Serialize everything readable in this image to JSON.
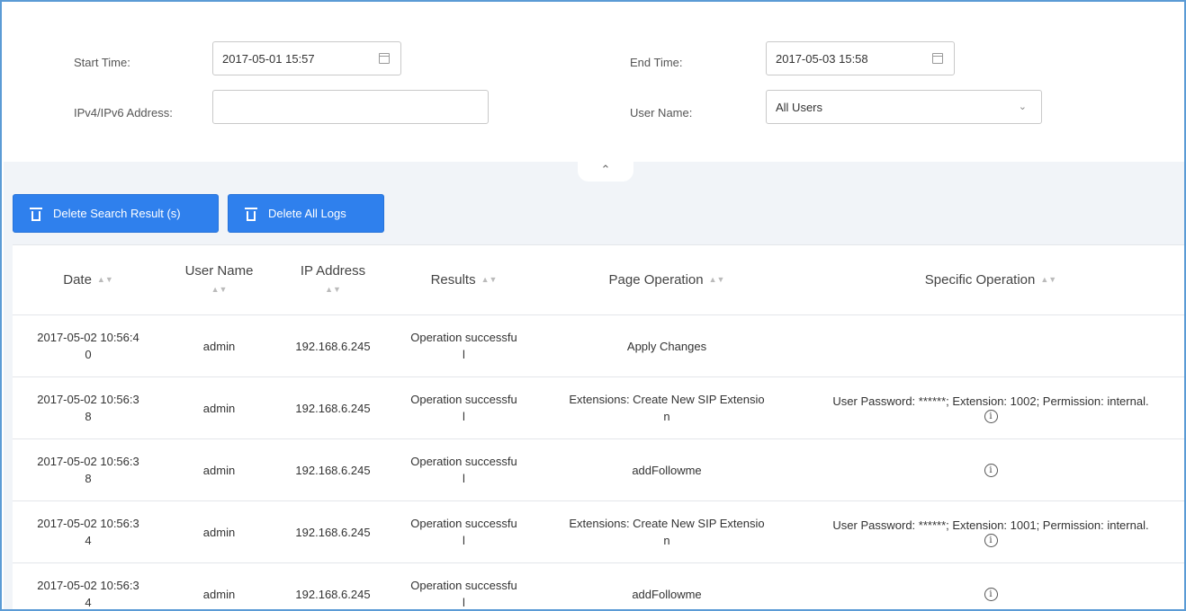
{
  "filter": {
    "start_time_label": "Start Time:",
    "start_time_value": "2017-05-01 15:57",
    "end_time_label": "End Time:",
    "end_time_value": "2017-05-03 15:58",
    "ip_label": "IPv4/IPv6 Address:",
    "ip_value": "",
    "user_label": "User Name:",
    "user_value": "All Users"
  },
  "toolbar": {
    "delete_search_label": "Delete Search Result (s)",
    "delete_all_label": "Delete All Logs"
  },
  "table": {
    "headers": {
      "date": "Date",
      "user": "User Name",
      "ip": "IP Address",
      "results": "Results",
      "page_op": "Page Operation",
      "specific_op": "Specific Operation"
    },
    "rows": [
      {
        "date_l1": "2017-05-02 10:56:4",
        "date_l2": "0",
        "user": "admin",
        "ip": "192.168.6.245",
        "result_l1": "Operation successfu",
        "result_l2": "l",
        "page_l1": "Apply Changes",
        "page_l2": "",
        "spec": "",
        "info": false
      },
      {
        "date_l1": "2017-05-02 10:56:3",
        "date_l2": "8",
        "user": "admin",
        "ip": "192.168.6.245",
        "result_l1": "Operation successfu",
        "result_l2": "l",
        "page_l1": "Extensions: Create New SIP Extensio",
        "page_l2": "n",
        "spec": "User Password: ******; Extension: 1002; Permission: internal.",
        "info": true
      },
      {
        "date_l1": "2017-05-02 10:56:3",
        "date_l2": "8",
        "user": "admin",
        "ip": "192.168.6.245",
        "result_l1": "Operation successfu",
        "result_l2": "l",
        "page_l1": "addFollowme",
        "page_l2": "",
        "spec": "",
        "info": true
      },
      {
        "date_l1": "2017-05-02 10:56:3",
        "date_l2": "4",
        "user": "admin",
        "ip": "192.168.6.245",
        "result_l1": "Operation successfu",
        "result_l2": "l",
        "page_l1": "Extensions: Create New SIP Extensio",
        "page_l2": "n",
        "spec": "User Password: ******; Extension: 1001; Permission: internal.",
        "info": true
      },
      {
        "date_l1": "2017-05-02 10:56:3",
        "date_l2": "4",
        "user": "admin",
        "ip": "192.168.6.245",
        "result_l1": "Operation successfu",
        "result_l2": "l",
        "page_l1": "addFollowme",
        "page_l2": "",
        "spec": "",
        "info": true
      }
    ]
  },
  "icons": {
    "calendar": "calendar-icon",
    "chevron_down": "chevron-down-icon",
    "chevron_up": "chevron-up-icon",
    "trash": "trash-icon",
    "sort": "sort-icon",
    "info": "info-icon"
  },
  "colors": {
    "accent": "#2f80ed",
    "frame": "#5b9bd5",
    "band": "#f1f4f8"
  }
}
